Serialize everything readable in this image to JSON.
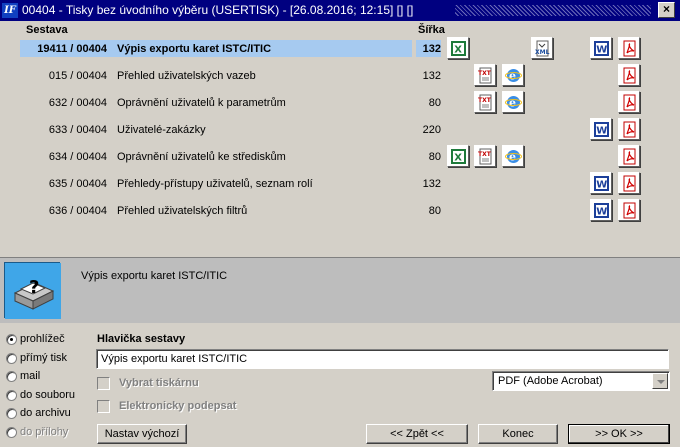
{
  "window": {
    "title": "00404 - Tisky bez úvodního výběru (USERTISK) - [26.08.2016; 12:15] [] []",
    "app_icon_text": "IF",
    "close_label": "×"
  },
  "list": {
    "headers": {
      "sestava": "Sestava",
      "sirka": "Šířka"
    },
    "rows": [
      {
        "code": "19411 / 00404",
        "name": "Výpis exportu karet ISTC/ITIC",
        "width": "132",
        "selected": true,
        "icons": [
          "xls-icon",
          "xml-icon",
          "word-icon",
          "pdf-icon"
        ]
      },
      {
        "code": "015 / 00404",
        "name": "Přehled uživatelských vazeb",
        "width": "132",
        "selected": false,
        "icons": [
          "txt-icon",
          "ie-icon",
          "pdf-icon"
        ]
      },
      {
        "code": "632 / 00404",
        "name": "Oprávnění uživatelů k parametrům",
        "width": "80",
        "selected": false,
        "icons": [
          "txt-icon",
          "ie-icon",
          "pdf-icon"
        ]
      },
      {
        "code": "633 / 00404",
        "name": "Uživatelé-zakázky",
        "width": "220",
        "selected": false,
        "icons": [
          "word-icon",
          "pdf-icon"
        ]
      },
      {
        "code": "634 / 00404",
        "name": "Oprávnění uživatelů ke střediskům",
        "width": "80",
        "selected": false,
        "icons": [
          "xls-icon",
          "txt-icon",
          "ie-icon",
          "pdf-icon"
        ]
      },
      {
        "code": "635 / 00404",
        "name": "Přehledy-přístupy uživatelů, seznam rolí",
        "width": "132",
        "selected": false,
        "icons": [
          "word-icon",
          "pdf-icon"
        ]
      },
      {
        "code": "636 / 00404",
        "name": "Přehled uživatelských filtrů",
        "width": "80",
        "selected": false,
        "icons": [
          "word-icon",
          "pdf-icon"
        ]
      }
    ]
  },
  "info": {
    "text": "Výpis exportu karet ISTC/ITIC",
    "icon": "printer-help-icon"
  },
  "output": {
    "options": [
      {
        "label": "prohlížeč",
        "checked": true,
        "disabled": false
      },
      {
        "label": "přímý tisk",
        "checked": false,
        "disabled": false
      },
      {
        "label": "mail",
        "checked": false,
        "disabled": false
      },
      {
        "label": "do souboru",
        "checked": false,
        "disabled": false
      },
      {
        "label": "do archivu",
        "checked": false,
        "disabled": false
      },
      {
        "label": "do přílohy",
        "checked": false,
        "disabled": true
      }
    ]
  },
  "header_section": {
    "title": "Hlavička sestavy",
    "value": "Výpis exportu karet ISTC/ITIC",
    "select_printer": "Vybrat tiskárnu",
    "sign_electronic": "Elektronicky podepsat",
    "format_value": "PDF (Adobe Acrobat)"
  },
  "buttons": {
    "defaults": "Nastav výchozí",
    "back": "<< Zpět <<",
    "finish": "Konec",
    "ok": ">> OK >>"
  },
  "colors": {
    "selection": "#a6caf0",
    "titlebar": "#000080",
    "face": "#d4d0c8"
  }
}
